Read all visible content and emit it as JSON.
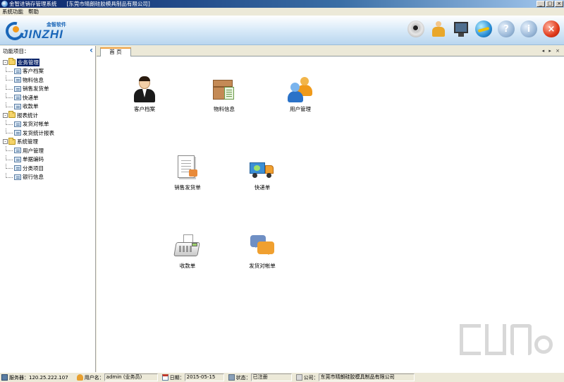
{
  "window": {
    "title": "金智进销存管理系统",
    "subtitle": "[东莞市晴朗硅胶模具制品有限公司]",
    "controls": [
      "_",
      "□",
      "×"
    ]
  },
  "menubar": {
    "items": [
      "系统功能",
      "帮助"
    ]
  },
  "logo": {
    "cn_text": "金智软件",
    "en_text": "JINZHI"
  },
  "toolbar": {
    "icons": [
      "webcam-icon",
      "user-icon",
      "monitor-icon",
      "globe-icon",
      "help-icon",
      "info-icon",
      "close-icon"
    ]
  },
  "sidebar": {
    "title": "功能项目：",
    "collapse_glyph": "‹",
    "groups": [
      {
        "label": "业务管理",
        "toggle": "-",
        "items": [
          "客户档案",
          "物料信息",
          "销售发货单",
          "快递单",
          "收款单"
        ]
      },
      {
        "label": "报表统计",
        "toggle": "-",
        "items": [
          "发货对帐单",
          "发货统计报表"
        ]
      },
      {
        "label": "系统管理",
        "toggle": "-",
        "items": [
          "用户管理",
          "单据编码",
          "分类项目",
          "银行信息"
        ]
      }
    ]
  },
  "tabs": {
    "active": "首 页",
    "nav": "◂ ▸ ×"
  },
  "desktop": {
    "items": [
      {
        "label": "客户档案",
        "icon": "customer-icon"
      },
      {
        "label": "物料信息",
        "icon": "material-icon"
      },
      {
        "label": "用户管理",
        "icon": "users-icon"
      },
      {
        "label": "销售发货单",
        "icon": "invoice-icon"
      },
      {
        "label": "快递单",
        "icon": "express-truck-icon"
      },
      {
        "label": "收款单",
        "icon": "cash-register-icon"
      },
      {
        "label": "发货对帐单",
        "icon": "reconcile-icon"
      }
    ]
  },
  "statusbar": {
    "server_label": "服务器：",
    "server_value": "120.25.222.107",
    "user_label": "用户名：",
    "user_value": "admin (业务员)",
    "date_label": "日期：",
    "date_value": "2015-05-15",
    "status_label": "状态：",
    "status_value": "已注册",
    "company_label": "公司：",
    "company_value": "东莞市晴朗硅胶模具制品有限公司"
  },
  "colors": {
    "titlebar_start": "#0a246a",
    "selection": "#0a246a",
    "tab_accent": "#f0a040",
    "brand_blue": "#1a66b8"
  }
}
